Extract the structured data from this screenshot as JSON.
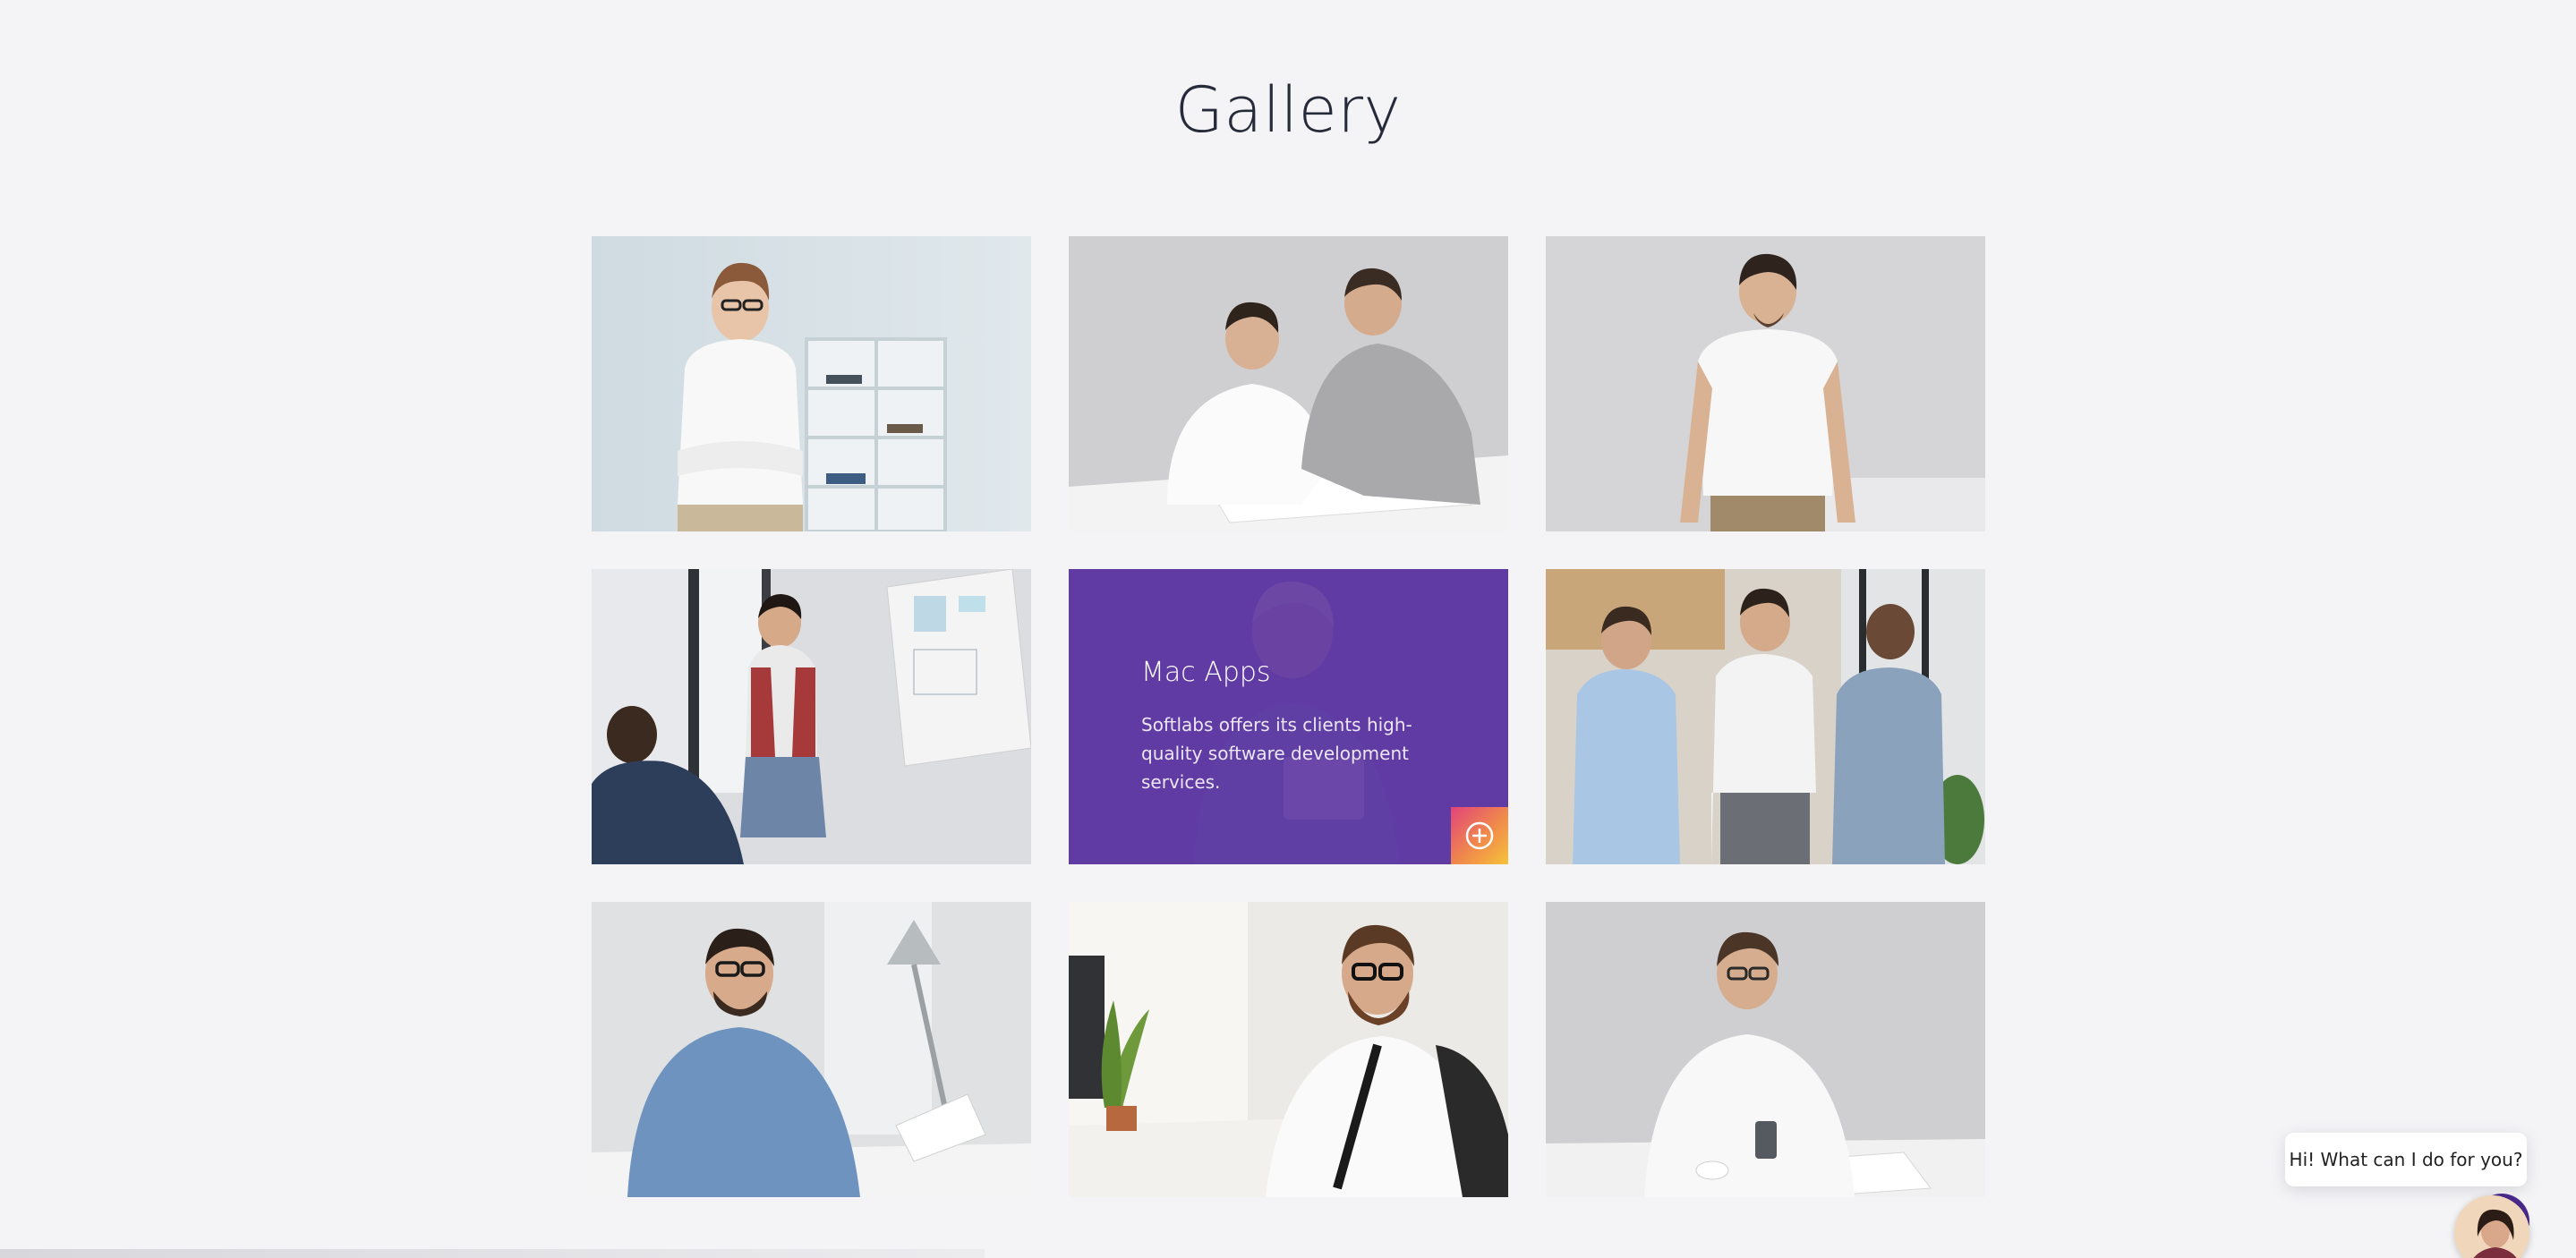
{
  "section": {
    "title": "Gallery"
  },
  "gallery": {
    "items": [
      {
        "name": "woman-in-white-shirt-photo"
      },
      {
        "name": "two-men-at-desk-photo"
      },
      {
        "name": "man-in-white-tshirt-photo"
      },
      {
        "name": "woman-presenting-photo"
      },
      {
        "name": "featured-item",
        "title": "Mac Apps",
        "description": "Softlabs offers its clients high-quality software development services."
      },
      {
        "name": "three-men-photo"
      },
      {
        "name": "smiling-man-denim-photo"
      },
      {
        "name": "bearded-man-desk-photo"
      },
      {
        "name": "man-with-phone-photo"
      }
    ],
    "accent_colors": {
      "overlay": "#5e37a2",
      "plus_gradient_start": "#e2447a",
      "plus_gradient_end": "#f6c23a"
    }
  },
  "chat": {
    "greeting": "Hi! What can I do for you?"
  }
}
